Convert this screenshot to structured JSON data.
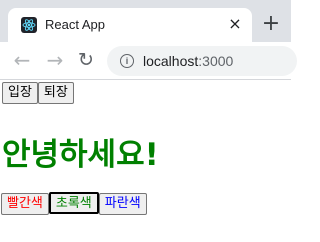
{
  "browser": {
    "tab": {
      "title": "React App",
      "favicon": "react-logo-icon",
      "close": "×"
    },
    "new_tab": "+",
    "nav": {
      "back": "←",
      "forward": "→",
      "reload": "↻"
    },
    "address": {
      "host": "localhost",
      "port": ":3000"
    }
  },
  "page": {
    "enter_label": "입장",
    "exit_label": "퇴장",
    "greeting": "안녕하세요!",
    "color_buttons": [
      {
        "label": "빨간색",
        "color": "#ff0000"
      },
      {
        "label": "초록색",
        "color": "#008000"
      },
      {
        "label": "파란색",
        "color": "#0000ff"
      }
    ],
    "greeting_color": "#008000"
  }
}
